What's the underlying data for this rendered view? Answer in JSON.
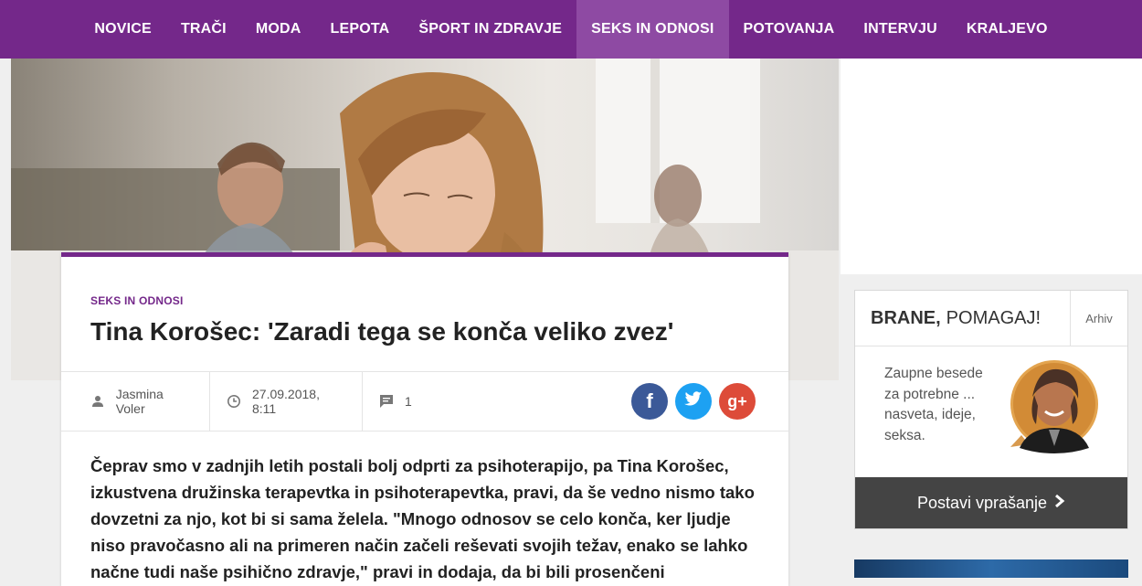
{
  "nav": {
    "items": [
      {
        "label": "NOVICE"
      },
      {
        "label": "TRAČI"
      },
      {
        "label": "MODA"
      },
      {
        "label": "LEPOTA"
      },
      {
        "label": "ŠPORT IN ZDRAVJE"
      },
      {
        "label": "SEKS IN ODNOSI",
        "active": true
      },
      {
        "label": "POTOVANJA"
      },
      {
        "label": "INTERVJU"
      },
      {
        "label": "KRALJEVO"
      }
    ],
    "accent_color": "#74288a"
  },
  "article": {
    "category": "SEKS IN ODNOSI",
    "title": "Tina Korošec: 'Zaradi tega se konča veliko zvez'",
    "author": "Jasmina Voler",
    "date": "27.09.2018, 8:11",
    "comments": "1",
    "lead": "Čeprav smo v zadnjih letih postali bolj odprti za psihoterapijo, pa Tina Korošec, izkustvena družinska terapevtka in psihoterapevtka, pravi, da še vedno nismo tako dovzetni za njo, kot bi si sama želela. \"Mnogo odnosov se celo konča, ker ljudje niso pravočasno ali na primeren način začeli reševati svojih težav, enako se lahko načne tudi naše psihično zdravje,\" pravi in dodaja, da bi bili prosenčeni",
    "share": {
      "facebook": "f",
      "twitter": "t",
      "googleplus": "g+"
    }
  },
  "sidebar": {
    "brane": {
      "title_bold": "BRANE,",
      "title_rest": "POMAGAJ!",
      "archive": "Arhiv",
      "text": "Zaupne besede za potrebne ... nasveta, ideje, seksa.",
      "button": "Postavi vprašanje"
    }
  },
  "icons": {
    "author": "user-icon",
    "date": "clock-icon",
    "comments": "comment-icon",
    "chevron": "chevron-right-icon"
  }
}
